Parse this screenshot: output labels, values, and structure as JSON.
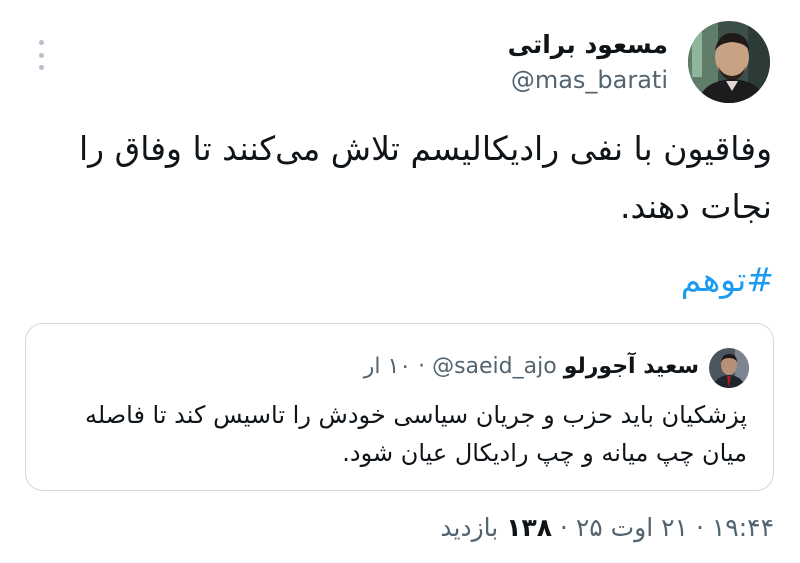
{
  "tweet": {
    "author": {
      "name": "مسعود براتی",
      "handle": "@mas_barati",
      "avatar_icon": "person-avatar"
    },
    "text": "وفاقیون با نفی رادیکالیسم تلاش می‌کنند تا وفاق را نجات دهند.",
    "hashtag": "#توهم",
    "more_icon": "more-vertical-icon"
  },
  "quote": {
    "author": {
      "name": "سعید آجورلو",
      "handle": "@saeid_ajo",
      "avatar_icon": "person-avatar"
    },
    "separator": "·",
    "time": "۱۰ ار",
    "text": "پزشکیان باید حزب و جریان سیاسی خودش را تاسیس کند تا فاصله میان چپ میانه و چپ رادیکال عیان شود."
  },
  "meta": {
    "time": "۱۹:۴۴",
    "date": "۲۱ اوت ۲۵",
    "views_count": "۱۳۸",
    "views_label": "بازدید",
    "separator": "·"
  },
  "colors": {
    "link": "#1d9bf0",
    "secondary_text": "#536471",
    "border": "#cfd9de"
  }
}
